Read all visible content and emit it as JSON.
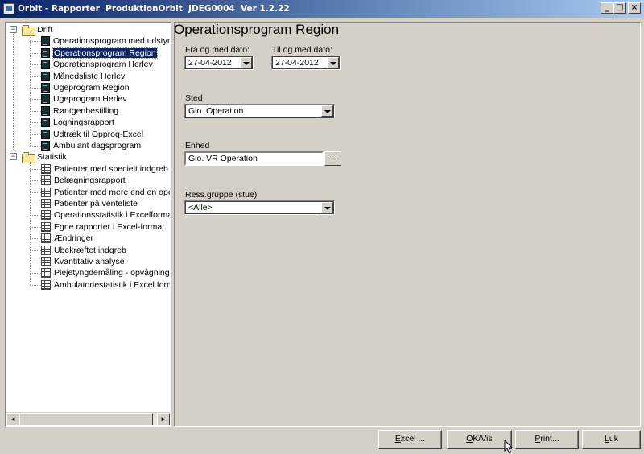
{
  "window": {
    "title": "Orbit - Rapporter  ProduktionOrbit  JDEG0004  Ver 1.2.22",
    "minimize": "_",
    "maximize": "□",
    "close": "×"
  },
  "tree": {
    "groups": [
      {
        "label": "Drift",
        "expander": "−",
        "items": [
          {
            "label": "Operationsprogram med udstyr",
            "icon": "report-icon"
          },
          {
            "label": "Operationsprogram Region",
            "icon": "report-icon",
            "selected": true
          },
          {
            "label": "Operationsprogram Herlev",
            "icon": "report-icon"
          },
          {
            "label": "Månedsliste Herlev",
            "icon": "report-icon"
          },
          {
            "label": "Ugeprogram Region",
            "icon": "report-icon"
          },
          {
            "label": "Ugeprogram Herlev",
            "icon": "report-icon"
          },
          {
            "label": "Røntgenbestilling",
            "icon": "report-icon"
          },
          {
            "label": "Logningsrapport",
            "icon": "report-icon"
          },
          {
            "label": "Udtræk til Opprog-Excel",
            "icon": "report-icon"
          },
          {
            "label": "Ambulant dagsprogram",
            "icon": "report-icon"
          }
        ]
      },
      {
        "label": "Statistik",
        "expander": "−",
        "items": [
          {
            "label": "Patienter med specielt indgreb",
            "icon": "grid-icon"
          },
          {
            "label": "Belægningsrapport",
            "icon": "grid-icon"
          },
          {
            "label": "Patienter med mere end en operati",
            "icon": "grid-icon"
          },
          {
            "label": "Patienter på venteliste",
            "icon": "grid-icon"
          },
          {
            "label": "Operationsstatistik i Excelformat",
            "icon": "grid-icon"
          },
          {
            "label": "Egne rapporter i Excel-format",
            "icon": "grid-icon"
          },
          {
            "label": "Ændringer",
            "icon": "grid-icon"
          },
          {
            "label": "Ubekræftet indgreb",
            "icon": "grid-icon"
          },
          {
            "label": "Kvantitativ analyse",
            "icon": "grid-icon"
          },
          {
            "label": "Plejetyngdemåling - opvågning",
            "icon": "grid-icon"
          },
          {
            "label": "Ambulatoriestatistik i Excel format",
            "icon": "grid-icon"
          }
        ]
      }
    ],
    "scroll_left": "◄",
    "scroll_right": "►"
  },
  "form": {
    "title": "Operationsprogram Region",
    "from_date": {
      "label": "Fra og med dato:",
      "value": "27-04-2012"
    },
    "to_date": {
      "label": "Til og med dato:",
      "value": "27-04-2012"
    },
    "sted": {
      "label": "Sted",
      "value": "Glo. Operation"
    },
    "enhed": {
      "label": "Enhed",
      "value": "Glo. VR Operation",
      "browse": "..."
    },
    "ress": {
      "label": "Ress.gruppe (stue)",
      "value": "<Alle>"
    }
  },
  "buttons": {
    "excel": {
      "first": "E",
      "rest": "xcel ..."
    },
    "ok": {
      "first": "O",
      "rest": "K/Vis"
    },
    "print": {
      "first": "P",
      "rest": "rint..."
    },
    "luk": {
      "first": "L",
      "rest": "uk"
    }
  }
}
